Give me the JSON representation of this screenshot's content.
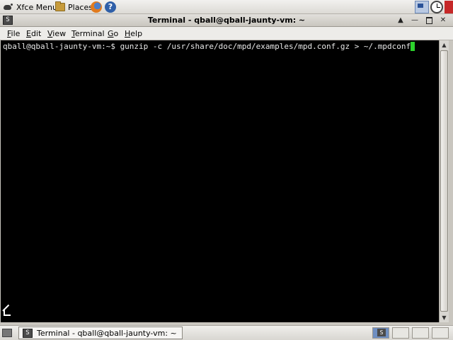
{
  "top_panel": {
    "xfce_menu_label": "Xfce Menu",
    "places_label": "Places",
    "help_glyph": "?"
  },
  "window": {
    "title": "Terminal - qball@qball-jaunty-vm: ~",
    "menu_icon_glyph": "S",
    "controls": {
      "up": "▲",
      "minimize": "—",
      "close": "✕"
    }
  },
  "menubar": {
    "file": {
      "u": "F",
      "rest": "ile"
    },
    "edit": {
      "u": "E",
      "rest": "dit"
    },
    "view": {
      "u": "V",
      "rest": "iew"
    },
    "terminal": {
      "u": "T",
      "rest": "erminal"
    },
    "go": {
      "u": "G",
      "rest": "o"
    },
    "help": {
      "u": "H",
      "rest": "elp"
    }
  },
  "terminal": {
    "line": "qball@qball-jaunty-vm:~$ gunzip -c /usr/share/doc/mpd/examples/mpd.conf.gz > ~/.mpdconf",
    "cursor_color": "#2cd12c",
    "background": "#000000"
  },
  "scrollbar": {
    "up_arrow": "▲",
    "down_arrow": "▼"
  },
  "taskbar": {
    "task_label": "Terminal - qball@qball-jaunty-vm: ~",
    "task_icon_glyph": "S"
  }
}
